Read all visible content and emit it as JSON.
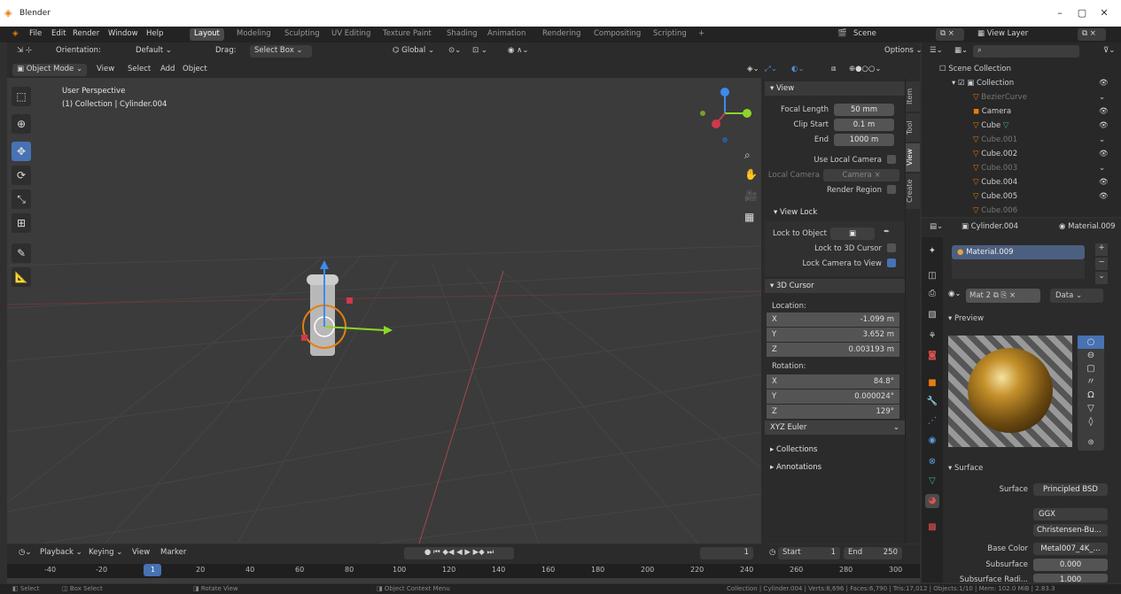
{
  "window": {
    "title": "Blender"
  },
  "menus": [
    "File",
    "Edit",
    "Render",
    "Window",
    "Help"
  ],
  "workspaces": [
    "Layout",
    "Modeling",
    "Sculpting",
    "UV Editing",
    "Texture Paint",
    "Shading",
    "Animation",
    "Rendering",
    "Compositing",
    "Scripting"
  ],
  "scene_name": "Scene",
  "view_layer": "View Layer",
  "tool_header": {
    "orientation_label": "Orientation:",
    "orientation_value": "Default",
    "drag_label": "Drag:",
    "drag_value": "Select Box",
    "transform": "Global",
    "options": "Options"
  },
  "vp_header": {
    "mode": "Object Mode",
    "view": "View",
    "select": "Select",
    "add": "Add",
    "object": "Object"
  },
  "viewport": {
    "perspective": "User Perspective",
    "collection_info": "(1) Collection | Cylinder.004"
  },
  "npanel": {
    "tabs": [
      "Item",
      "Tool",
      "View",
      "Create"
    ],
    "view": {
      "title": "View",
      "focal_label": "Focal Length",
      "focal": "50 mm",
      "clip_start_label": "Clip Start",
      "clip_start": "0.1 m",
      "end_label": "End",
      "end": "1000 m",
      "local_cam_label": "Use Local Camera",
      "local_camera_label": "Local Camera",
      "local_camera": "Camera",
      "render_region": "Render Region"
    },
    "view_lock": {
      "title": "View Lock",
      "lock_obj": "Lock to Object",
      "lock_cursor": "Lock to 3D Cursor",
      "lock_camera": "Lock Camera to View"
    },
    "cursor": {
      "title": "3D Cursor",
      "location": "Location:",
      "loc": [
        {
          "a": "X",
          "v": "-1.099 m"
        },
        {
          "a": "Y",
          "v": "3.652 m"
        },
        {
          "a": "Z",
          "v": "0.003193 m"
        }
      ],
      "rotation": "Rotation:",
      "rot": [
        {
          "a": "X",
          "v": "84.8°"
        },
        {
          "a": "Y",
          "v": "0.000024°"
        },
        {
          "a": "Z",
          "v": "129°"
        }
      ],
      "mode": "XYZ Euler"
    },
    "collections": "Collections",
    "annotations": "Annotations"
  },
  "outliner": {
    "scene_collection": "Scene Collection",
    "items": [
      {
        "name": "Collection"
      },
      {
        "name": "BezierCurve"
      },
      {
        "name": "Camera"
      },
      {
        "name": "Cube"
      },
      {
        "name": "Cube.001"
      },
      {
        "name": "Cube.002"
      },
      {
        "name": "Cube.003"
      },
      {
        "name": "Cube.004"
      },
      {
        "name": "Cube.005"
      },
      {
        "name": "Cube.006"
      }
    ]
  },
  "props": {
    "object": "Cylinder.004",
    "material": "Material.009",
    "slot": "Material.009",
    "mat_short": "Mat",
    "users": "2",
    "data": "Data",
    "preview": "Preview",
    "surface_section": "Surface",
    "surface_label": "Surface",
    "surface_value": "Principled BSD",
    "dist": "GGX",
    "sss_method": "Christensen-Bu...",
    "base_color_label": "Base Color",
    "base_color_value": "Metal007_4K_...",
    "subsurface_label": "Subsurface",
    "subsurface_value": "0.000",
    "subsurface_radius_label": "Subsurface Radi...",
    "subsurface_radius_value": "1.000"
  },
  "timeline": {
    "playback": "Playback",
    "keying": "Keying",
    "view": "View",
    "marker": "Marker",
    "current": "1",
    "start_label": "Start",
    "start": "1",
    "end_label": "End",
    "end": "250",
    "ticks": [
      "-40",
      "-20",
      "1",
      "20",
      "40",
      "60",
      "80",
      "100",
      "120",
      "140",
      "160",
      "180",
      "200",
      "220",
      "240",
      "260",
      "280",
      "300"
    ]
  },
  "status": {
    "select": "Select",
    "box_select": "Box Select",
    "rotate": "Rotate View",
    "context": "Object Context Menu",
    "stats": "Collection | Cylinder.004 | Verts:8,696 | Faces:6,790 | Tris:17,012 | Objects:1/10 | Mem: 102.0 MiB | 2.83.3"
  }
}
